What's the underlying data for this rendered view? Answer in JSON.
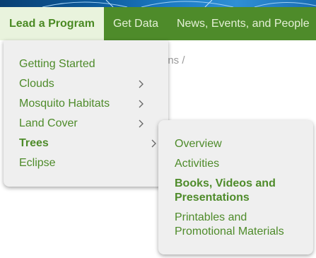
{
  "nav": {
    "items": [
      {
        "label": "Lead a Program",
        "active": true
      },
      {
        "label": "Get Data",
        "active": false
      },
      {
        "label": "News, Events, and People",
        "active": false
      }
    ]
  },
  "breadcrumb": {
    "fragment": "ons /"
  },
  "menu": {
    "items": [
      {
        "label": "Getting Started",
        "has_submenu": false,
        "bold": false
      },
      {
        "label": "Clouds",
        "has_submenu": true,
        "bold": false
      },
      {
        "label": "Mosquito Habitats",
        "has_submenu": true,
        "bold": false
      },
      {
        "label": "Land Cover",
        "has_submenu": true,
        "bold": false
      },
      {
        "label": "Trees",
        "has_submenu": true,
        "bold": true
      },
      {
        "label": "Eclipse",
        "has_submenu": false,
        "bold": false
      }
    ]
  },
  "submenu": {
    "items": [
      {
        "label": "Overview",
        "bold": false
      },
      {
        "label": "Activities",
        "bold": false
      },
      {
        "label": "Books, Videos and Presentations",
        "bold": true
      },
      {
        "label": "Printables and Promotional Materials",
        "bold": false
      }
    ]
  },
  "colors": {
    "nav_green": "#4e8b2a",
    "active_tab_bg": "#e9f3dd",
    "menu_bg": "#efefef",
    "link_green": "#4e8b2a"
  }
}
